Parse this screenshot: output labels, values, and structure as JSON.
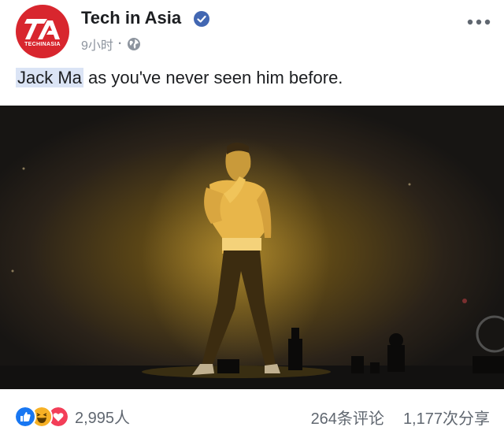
{
  "header": {
    "page_name": "Tech in Asia",
    "avatar_label": "TECHINASIA",
    "time": "9小时",
    "separator": "·"
  },
  "post": {
    "mention": "Jack Ma",
    "text_rest": " as you've never seen him before."
  },
  "footer": {
    "reaction_count": "2,995人",
    "comments": "264条评论",
    "shares": "1,177次分享"
  },
  "colors": {
    "brand_red": "#d8262e",
    "verified_blue": "#4267b2",
    "like_blue": "#1877f2",
    "haha_yellow": "#f7b125",
    "love_red": "#f33e58"
  }
}
